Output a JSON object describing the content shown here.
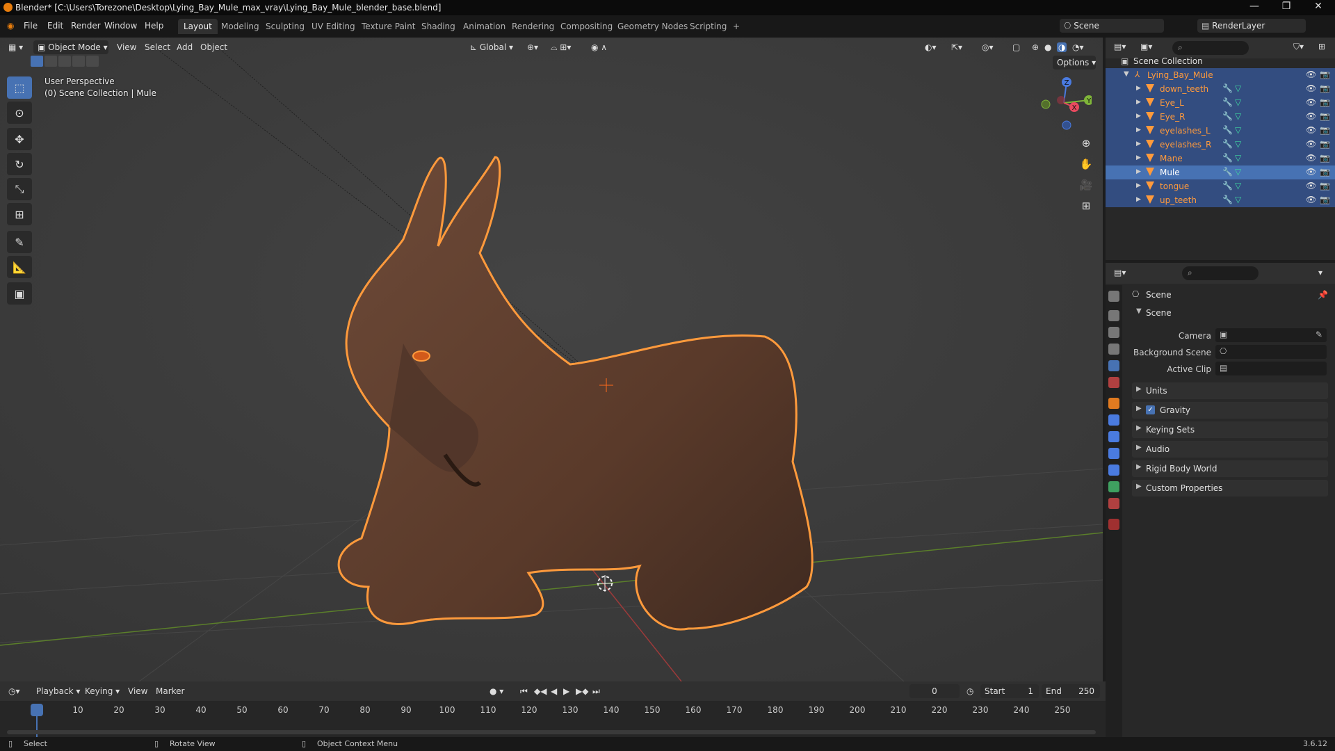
{
  "window": {
    "title": "Blender* [C:\\Users\\Torezone\\Desktop\\Lying_Bay_Mule_max_vray\\Lying_Bay_Mule_blender_base.blend]"
  },
  "menu": {
    "items": [
      "File",
      "Edit",
      "Render",
      "Window",
      "Help"
    ],
    "workspaces": [
      "Layout",
      "Modeling",
      "Sculpting",
      "UV Editing",
      "Texture Paint",
      "Shading",
      "Animation",
      "Rendering",
      "Compositing",
      "Geometry Nodes",
      "Scripting",
      "+"
    ],
    "active_workspace": "Layout",
    "scene": "Scene",
    "render_layer": "RenderLayer"
  },
  "viewport": {
    "mode": "Object Mode",
    "header_menus": [
      "View",
      "Select",
      "Add",
      "Object"
    ],
    "orientation": "Global",
    "options_label": "Options",
    "perspective_label": "User Perspective",
    "collection_label": "(0) Scene Collection | Mule",
    "gizmo": {
      "x": "X",
      "y": "Y",
      "z": "Z"
    }
  },
  "outliner": {
    "root": "Scene Collection",
    "collection": "Lying_Bay_Mule",
    "objects": [
      "down_teeth",
      "Eye_L",
      "Eye_R",
      "eyelashes_L",
      "eyelashes_R",
      "Mane",
      "Mule",
      "tongue",
      "up_teeth"
    ],
    "active_object": "Mule"
  },
  "properties": {
    "context_title": "Scene",
    "section_scene": "Scene",
    "fields": {
      "camera_label": "Camera",
      "background_scene_label": "Background Scene",
      "active_clip_label": "Active Clip"
    },
    "panels": [
      "Units",
      "Gravity",
      "Keying Sets",
      "Audio",
      "Rigid Body World",
      "Custom Properties"
    ],
    "gravity_enabled": true
  },
  "timeline": {
    "menus": [
      "Playback",
      "Keying",
      "View",
      "Marker"
    ],
    "current_frame": "0",
    "start_label": "Start",
    "start_value": "1",
    "end_label": "End",
    "end_value": "250",
    "ticks": [
      "0",
      "10",
      "20",
      "30",
      "40",
      "50",
      "60",
      "70",
      "80",
      "90",
      "100",
      "110",
      "120",
      "130",
      "140",
      "150",
      "160",
      "170",
      "180",
      "190",
      "200",
      "210",
      "220",
      "230",
      "240",
      "250"
    ]
  },
  "statusbar": {
    "select": "Select",
    "rotate": "Rotate View",
    "context_menu": "Object Context Menu",
    "version": "3.6.12"
  },
  "colors": {
    "accent": "#4772b3",
    "selection_outline": "#ff9a3c",
    "viewport_bg": "#3c3c3c"
  }
}
